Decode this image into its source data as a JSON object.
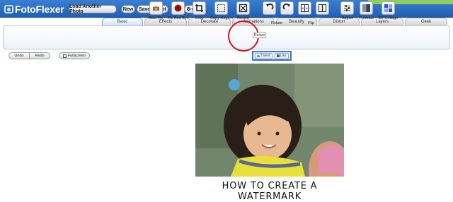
{
  "app": {
    "name": "FotoFlexer"
  },
  "topbar": {
    "load_another_photo": "Load Another Photo",
    "new": "New",
    "save": "Save",
    "quit": "Quit",
    "help": "?",
    "settings_caret": "▾"
  },
  "tabs": [
    "Basic",
    "Effects",
    "Decorate",
    "Animations",
    "Beautify",
    "Distort",
    "Layers",
    "Geek"
  ],
  "active_tab": "Basic",
  "tools": [
    {
      "label": "Auto Fix",
      "icon": "auto-fix-icon"
    },
    {
      "label": "Fix Red Eye",
      "icon": "red-eye-icon"
    },
    {
      "label": "Crop",
      "icon": "crop-icon"
    },
    {
      "label": "Copy Region",
      "icon": "copy-region-icon"
    },
    {
      "label": "Resize",
      "icon": "resize-icon"
    },
    {
      "label": "Rotate",
      "icon": "rotate-icon"
    },
    {
      "label": "Flip",
      "icon": "flip-icon"
    },
    {
      "label": "Adjust",
      "icon": "adjust-icon"
    },
    {
      "label": "Contrast",
      "icon": "contrast-icon"
    },
    {
      "label": "EZ Collage",
      "icon": "collage-icon"
    }
  ],
  "tooltip": "Resize",
  "history": {
    "undo": "Undo",
    "redo": "Redo",
    "fullscreen": "Fullscreen"
  },
  "social": {
    "tweet": "Tweet",
    "like": "Like"
  },
  "photo": {
    "caption": "HOW TO CREATE A WATERMARK"
  },
  "colors": {
    "topbar": "#2a6cc4",
    "accent_green": "#8fce5a",
    "highlight_ring": "#d6151a",
    "social_border": "#3a77c8"
  }
}
